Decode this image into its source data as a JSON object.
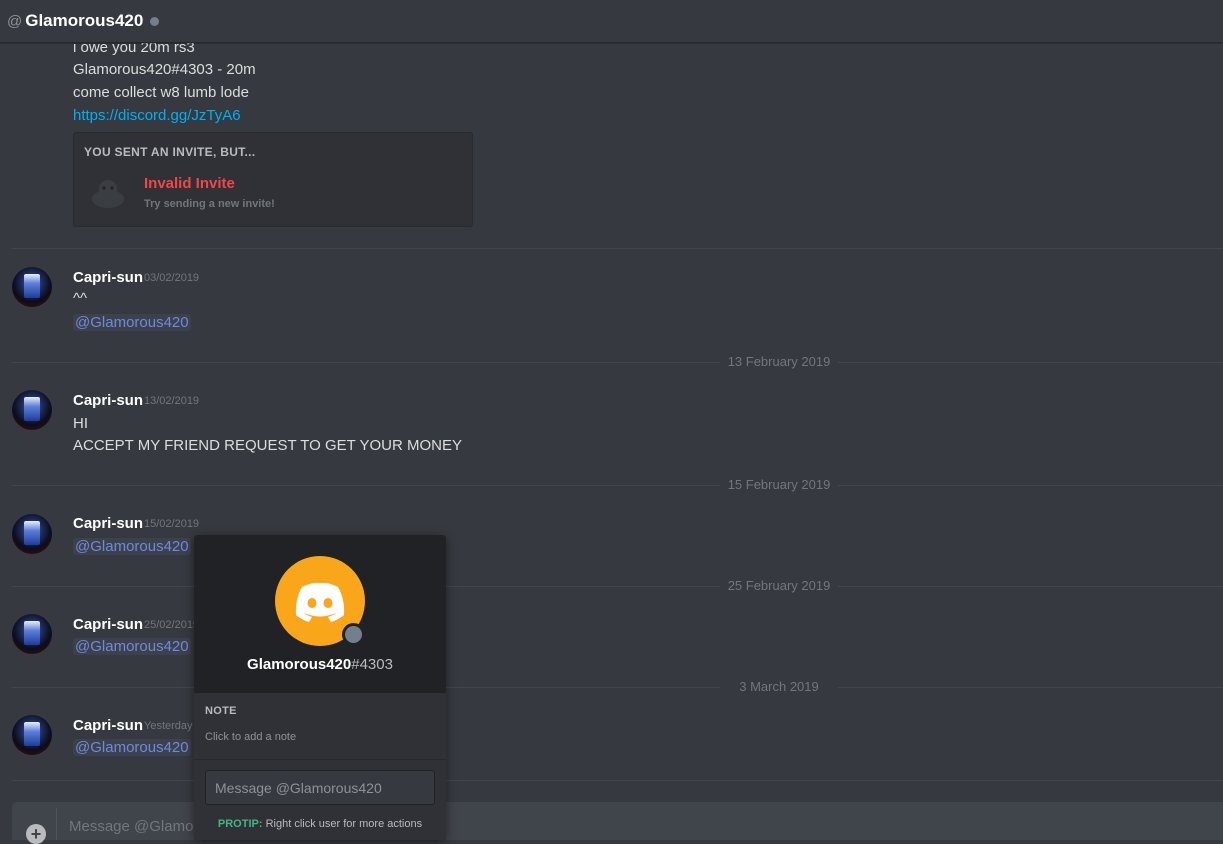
{
  "header": {
    "at_symbol": "@",
    "title": "Glamorous420"
  },
  "first_message": {
    "lines": [
      "i owe you 20m rs3",
      "Glamorous420#4303 - 20m",
      "come collect w8 lumb lode"
    ],
    "link": "https://discord.gg/JzTyA6",
    "embed": {
      "heading": "YOU SENT AN INVITE, BUT...",
      "title": "Invalid Invite",
      "subtitle": "Try sending a new invite!"
    }
  },
  "messages": [
    {
      "author": "Capri-sun",
      "timestamp": "03/02/2019",
      "text": "^^",
      "mention": "@Glamorous420"
    },
    {
      "author": "Capri-sun",
      "timestamp": "13/02/2019",
      "lines": [
        "HI",
        "ACCEPT MY FRIEND REQUEST TO GET YOUR MONEY"
      ]
    },
    {
      "author": "Capri-sun",
      "timestamp": "15/02/2019",
      "mention": "@Glamorous420"
    },
    {
      "author": "Capri-sun",
      "timestamp": "25/02/2019",
      "mention": "@Glamorous420"
    },
    {
      "author": "Capri-sun",
      "timestamp": "Yesterday",
      "mention": "@Glamorous420"
    }
  ],
  "date_dividers": [
    "13 February 2019",
    "15 February 2019",
    "25 February 2019",
    "3 March 2019"
  ],
  "composer": {
    "placeholder": "Message @Glamorous420"
  },
  "popout": {
    "username": "Glamorous420",
    "discriminator": "#4303",
    "note_label": "NOTE",
    "note_placeholder": "Click to add a note",
    "message_placeholder": "Message @Glamorous420",
    "protip_label": "PROTIP:",
    "protip_text": "Right click user for more actions"
  },
  "colors": {
    "background": "#36393f",
    "mention": "#7289da",
    "link": "#00b0f4",
    "invalid": "#f04747",
    "protip": "#43b581",
    "avatar_bg": "#faa61a"
  }
}
